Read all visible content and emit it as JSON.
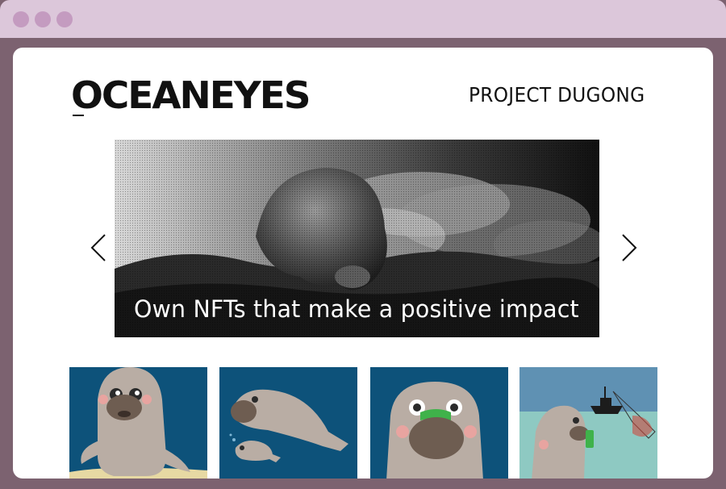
{
  "browser": {
    "traffic_lights": [
      "close",
      "minimize",
      "maximize"
    ]
  },
  "header": {
    "logo_text": "OCEANEYES",
    "project_link": "PROJECT DUGONG"
  },
  "hero": {
    "caption": "Own NFTs that make a positive impact",
    "prev_icon": "chevron-left-icon",
    "next_icon": "chevron-right-icon"
  },
  "gallery": {
    "items": [
      {
        "name": "dugong-smiling"
      },
      {
        "name": "dugong-with-calf"
      },
      {
        "name": "dugong-green-mask"
      },
      {
        "name": "dugong-fishing-boat"
      }
    ]
  },
  "colors": {
    "frame": "#7c6270",
    "titlebar": "#dcc7da",
    "thumb_background": "#0d527a",
    "accent_green": "#3fb24a"
  }
}
